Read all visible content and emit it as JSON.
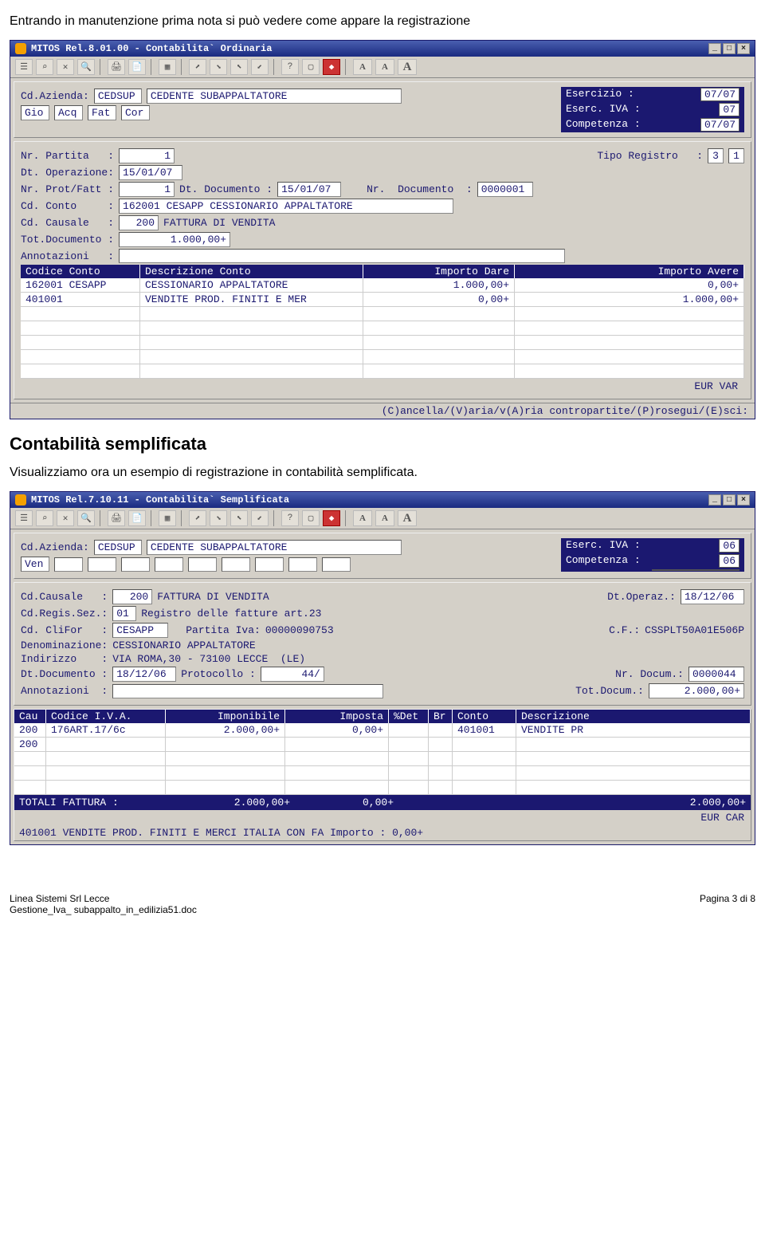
{
  "intro": "Entrando in manutenzione prima nota si può vedere come appare la registrazione",
  "win1": {
    "title": "MITOS Rel.8.01.00 - Contabilita` Ordinaria",
    "azienda_label": "Cd.Azienda:",
    "azienda_code": "CEDSUP",
    "azienda_desc": "CEDENTE SUBAPPALTATORE",
    "eserc_lbl": "Esercizio  :",
    "eserc_val": "07/07",
    "eserciva_lbl": "Eserc. IVA :",
    "eserciva_val": "07",
    "comp_lbl": "Competenza :",
    "comp_val": "07/07",
    "segments": [
      "Gio",
      "Acq",
      "Fat",
      "Cor"
    ],
    "fields": {
      "nr_partita_lbl": "Nr. Partita   :",
      "nr_partita": "1",
      "tipo_reg_lbl": "Tipo Registro   :",
      "tipo_reg_a": "3",
      "tipo_reg_b": "1",
      "dt_op_lbl": "Dt. Operazione:",
      "dt_op": "15/01/07",
      "nr_prot_lbl": "Nr. Prot/Fatt :",
      "nr_prot": "1",
      "dt_doc_lbl": "Dt. Documento :",
      "dt_doc": "15/01/07",
      "nr_doc_lbl": "Nr.  Documento  :",
      "nr_doc": "0000001",
      "cd_conto_lbl": "Cd. Conto     :",
      "cd_conto": "162001 CESAPP CESSIONARIO APPALTATORE",
      "cd_cau_lbl": "Cd. Causale   :",
      "cd_cau": "200",
      "cd_cau_desc": "FATTURA DI VENDITA",
      "tot_lbl": "Tot.Documento :",
      "tot": "1.000,00+",
      "ann_lbl": "Annotazioni   :"
    },
    "grid_headers": [
      "Codice Conto",
      "Descrizione Conto",
      "Importo Dare",
      "Importo Avere"
    ],
    "grid_rows": [
      {
        "cod": "162001 CESAPP",
        "desc": "CESSIONARIO APPALTATORE",
        "dare": "1.000,00+",
        "avere": "0,00+"
      },
      {
        "cod": "401001",
        "desc": "VENDITE PROD. FINITI E MER",
        "dare": "0,00+",
        "avere": "1.000,00+"
      }
    ],
    "curr": "EUR VAR",
    "hint": "(C)ancella/(V)aria/v(A)ria contropartite/(P)rosegui/(E)sci:"
  },
  "h2": "Contabilità semplificata",
  "intro2": "Visualizziamo ora un esempio di registrazione in contabilità semplificata.",
  "win2": {
    "title": "MITOS Rel.7.10.11 - Contabilita` Semplificata",
    "azienda_label": "Cd.Azienda:",
    "azienda_code": "CEDSUP",
    "azienda_desc": "CEDENTE SUBAPPALTATORE",
    "eserciva_lbl": "Eserc. IVA :",
    "eserciva_val": "06",
    "comp_lbl": "Competenza :",
    "comp_val": "06",
    "segment": "Ven",
    "fields": {
      "cd_cau_lbl": "Cd.Causale   :",
      "cd_cau": "200",
      "cd_cau_desc": "FATTURA DI VENDITA",
      "dt_op_lbl": "Dt.Operaz.:",
      "dt_op": "18/12/06",
      "cd_regis_lbl": "Cd.Regis.Sez.:",
      "cd_regis": "01",
      "cd_regis_desc": "Registro delle fatture art.23",
      "cd_clifor_lbl": "Cd. CliFor   :",
      "cd_clifor": "CESAPP",
      "piva_lbl": "Partita Iva:",
      "piva": "00000090753",
      "cf_lbl": "C.F.:",
      "cf": "CSSPLT50A01E506P",
      "denom_lbl": "Denominazione:",
      "denom": "CESSIONARIO APPALTATORE",
      "indir_lbl": "Indirizzo    :",
      "indir": "VIA ROMA,30 - 73100 LECCE  (LE)",
      "dtdoc_lbl": "Dt.Documento :",
      "dtdoc": "18/12/06",
      "proto_lbl": "Protocollo :",
      "proto": "44/",
      "nrdoc_lbl": "Nr. Docum.:",
      "nrdoc": "0000044",
      "ann_lbl": "Annotazioni  :",
      "totdoc_lbl": "Tot.Docum.:",
      "totdoc": "2.000,00+"
    },
    "grid_headers": [
      "Cau",
      "Codice I.V.A.",
      "Imponibile",
      "Imposta",
      "%Det",
      "Br",
      "Conto",
      "Descrizione"
    ],
    "grid_rows": [
      {
        "cau": "200",
        "iva": "176ART.17/6c",
        "imp": "2.000,00+",
        "impo": "0,00+",
        "det": "",
        "br": "",
        "conto": "401001",
        "desc": "VENDITE PR"
      },
      {
        "cau": "200",
        "iva": "",
        "imp": "",
        "impo": "",
        "det": "",
        "br": "",
        "conto": "",
        "desc": ""
      }
    ],
    "totals_lbl": "TOTALI FATTURA :",
    "totals_imp": "2.000,00+",
    "totals_impo": "0,00+",
    "totals_tot": "2.000,00+",
    "curr": "EUR CAR",
    "bottomline": "401001   VENDITE PROD. FINITI E MERCI ITALIA CON FA Importo :          0,00+"
  },
  "footer": {
    "left1": "Linea Sistemi Srl Lecce",
    "left2": "Gestione_Iva_ subappalto_in_edilizia51.doc",
    "right": "Pagina 3 di 8"
  }
}
